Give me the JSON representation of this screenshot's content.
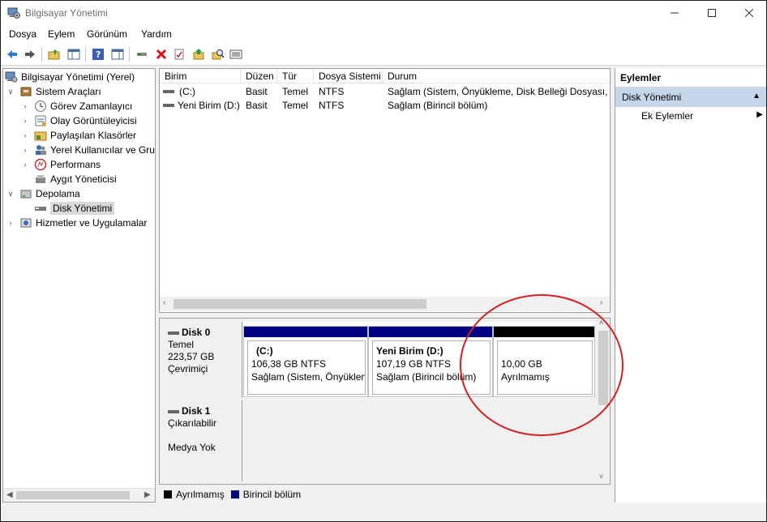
{
  "window": {
    "title": "Bilgisayar Yönetimi"
  },
  "menu": [
    "Dosya",
    "Eylem",
    "Görünüm",
    "Yardım"
  ],
  "toolbar": {
    "icons": [
      "back-arrow-icon",
      "forward-arrow-icon",
      "up-folder-icon",
      "show-hide-tree-icon",
      "help-icon",
      "show-hide-action-icon",
      "connect-icon",
      "delete-icon",
      "properties-icon",
      "open-icon",
      "search-icon",
      "list-icon"
    ]
  },
  "tree": {
    "root": "Bilgisayar Yönetimi (Yerel)",
    "system_tools": "Sistem Araçları",
    "task_scheduler": "Görev Zamanlayıcı",
    "event_viewer": "Olay Görüntüleyicisi",
    "shared_folders": "Paylaşılan Klasörler",
    "local_users": "Yerel Kullanıcılar ve Gru",
    "performance": "Performans",
    "device_manager": "Aygıt Yöneticisi",
    "storage": "Depolama",
    "disk_management": "Disk Yönetimi",
    "services": "Hizmetler ve Uygulamalar"
  },
  "volume_list": {
    "headers": [
      "Birim",
      "Düzen",
      "Tür",
      "Dosya Sistemi",
      "Durum"
    ],
    "rows": [
      [
        "(C:)",
        "Basit",
        "Temel",
        "NTFS",
        "Sağlam (Sistem, Önyükleme, Disk Belleği Dosyası, Etk"
      ],
      [
        "Yeni Birim (D:)",
        "Basit",
        "Temel",
        "NTFS",
        "Sağlam (Birincil bölüm)"
      ]
    ]
  },
  "disks": {
    "disk0": {
      "name": "Disk 0",
      "type": "Temel",
      "size": "223,57 GB",
      "status": "Çevrimiçi",
      "partitions": [
        {
          "name": "(C:)",
          "size": "106,38 GB NTFS",
          "status": "Sağlam (Sistem, Önyüklen",
          "bar_color": "#000080"
        },
        {
          "name": "Yeni Birim  (D:)",
          "size": "107,19 GB NTFS",
          "status": "Sağlam (Birincil bölüm)",
          "bar_color": "#000080"
        },
        {
          "name": "",
          "size": "10,00 GB",
          "status": "Ayrılmamış",
          "bar_color": "#000000"
        }
      ]
    },
    "disk1": {
      "name": "Disk 1",
      "type": "Çıkarılabilir",
      "status": "Medya Yok"
    }
  },
  "legend": {
    "unallocated": "Ayrılmamış",
    "unallocated_color": "#000000",
    "primary": "Birincil bölüm",
    "primary_color": "#000080"
  },
  "actions": {
    "header": "Eylemler",
    "section": "Disk Yönetimi",
    "more": "Ek Eylemler"
  }
}
